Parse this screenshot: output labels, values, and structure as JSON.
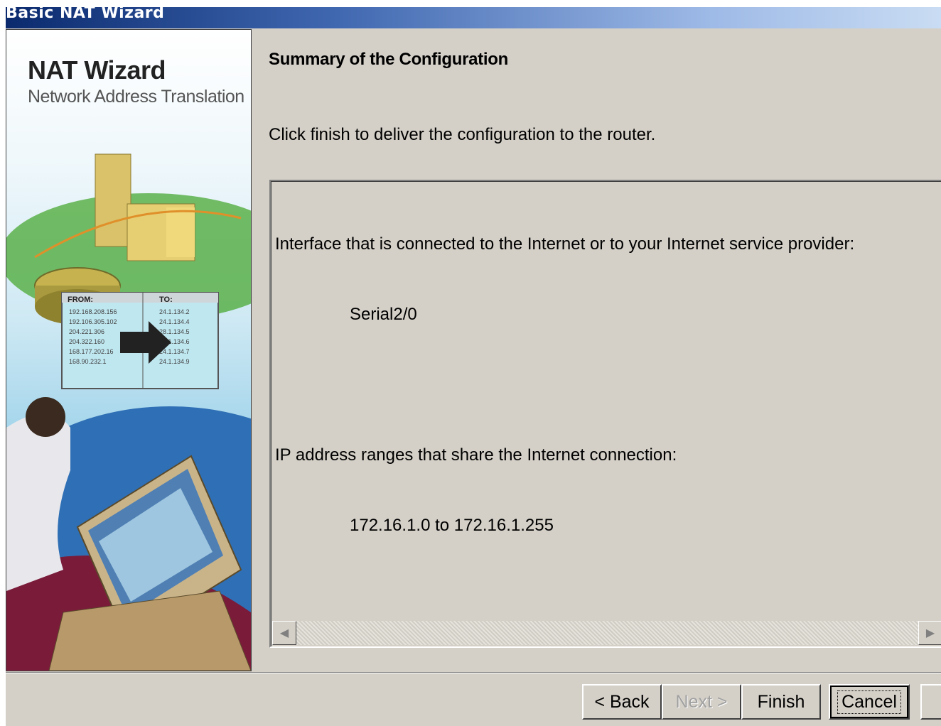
{
  "window": {
    "title": "Basic NAT Wizard"
  },
  "banner": {
    "title": "NAT Wizard",
    "subtitle": "Network Address Translation"
  },
  "content": {
    "heading": "Summary of the Configuration",
    "instruction": "Click finish to deliver the configuration to the router.",
    "summary": {
      "interface_label": "Interface that is connected to the Internet or to your Internet service provider:",
      "interface_value": "Serial2/0",
      "ranges_label": "IP address ranges that share the Internet connection:",
      "ranges_value": "172.16.1.0 to 172.16.1.255"
    }
  },
  "buttons": {
    "back": "< Back",
    "next": "Next >",
    "finish": "Finish",
    "cancel": "Cancel"
  }
}
